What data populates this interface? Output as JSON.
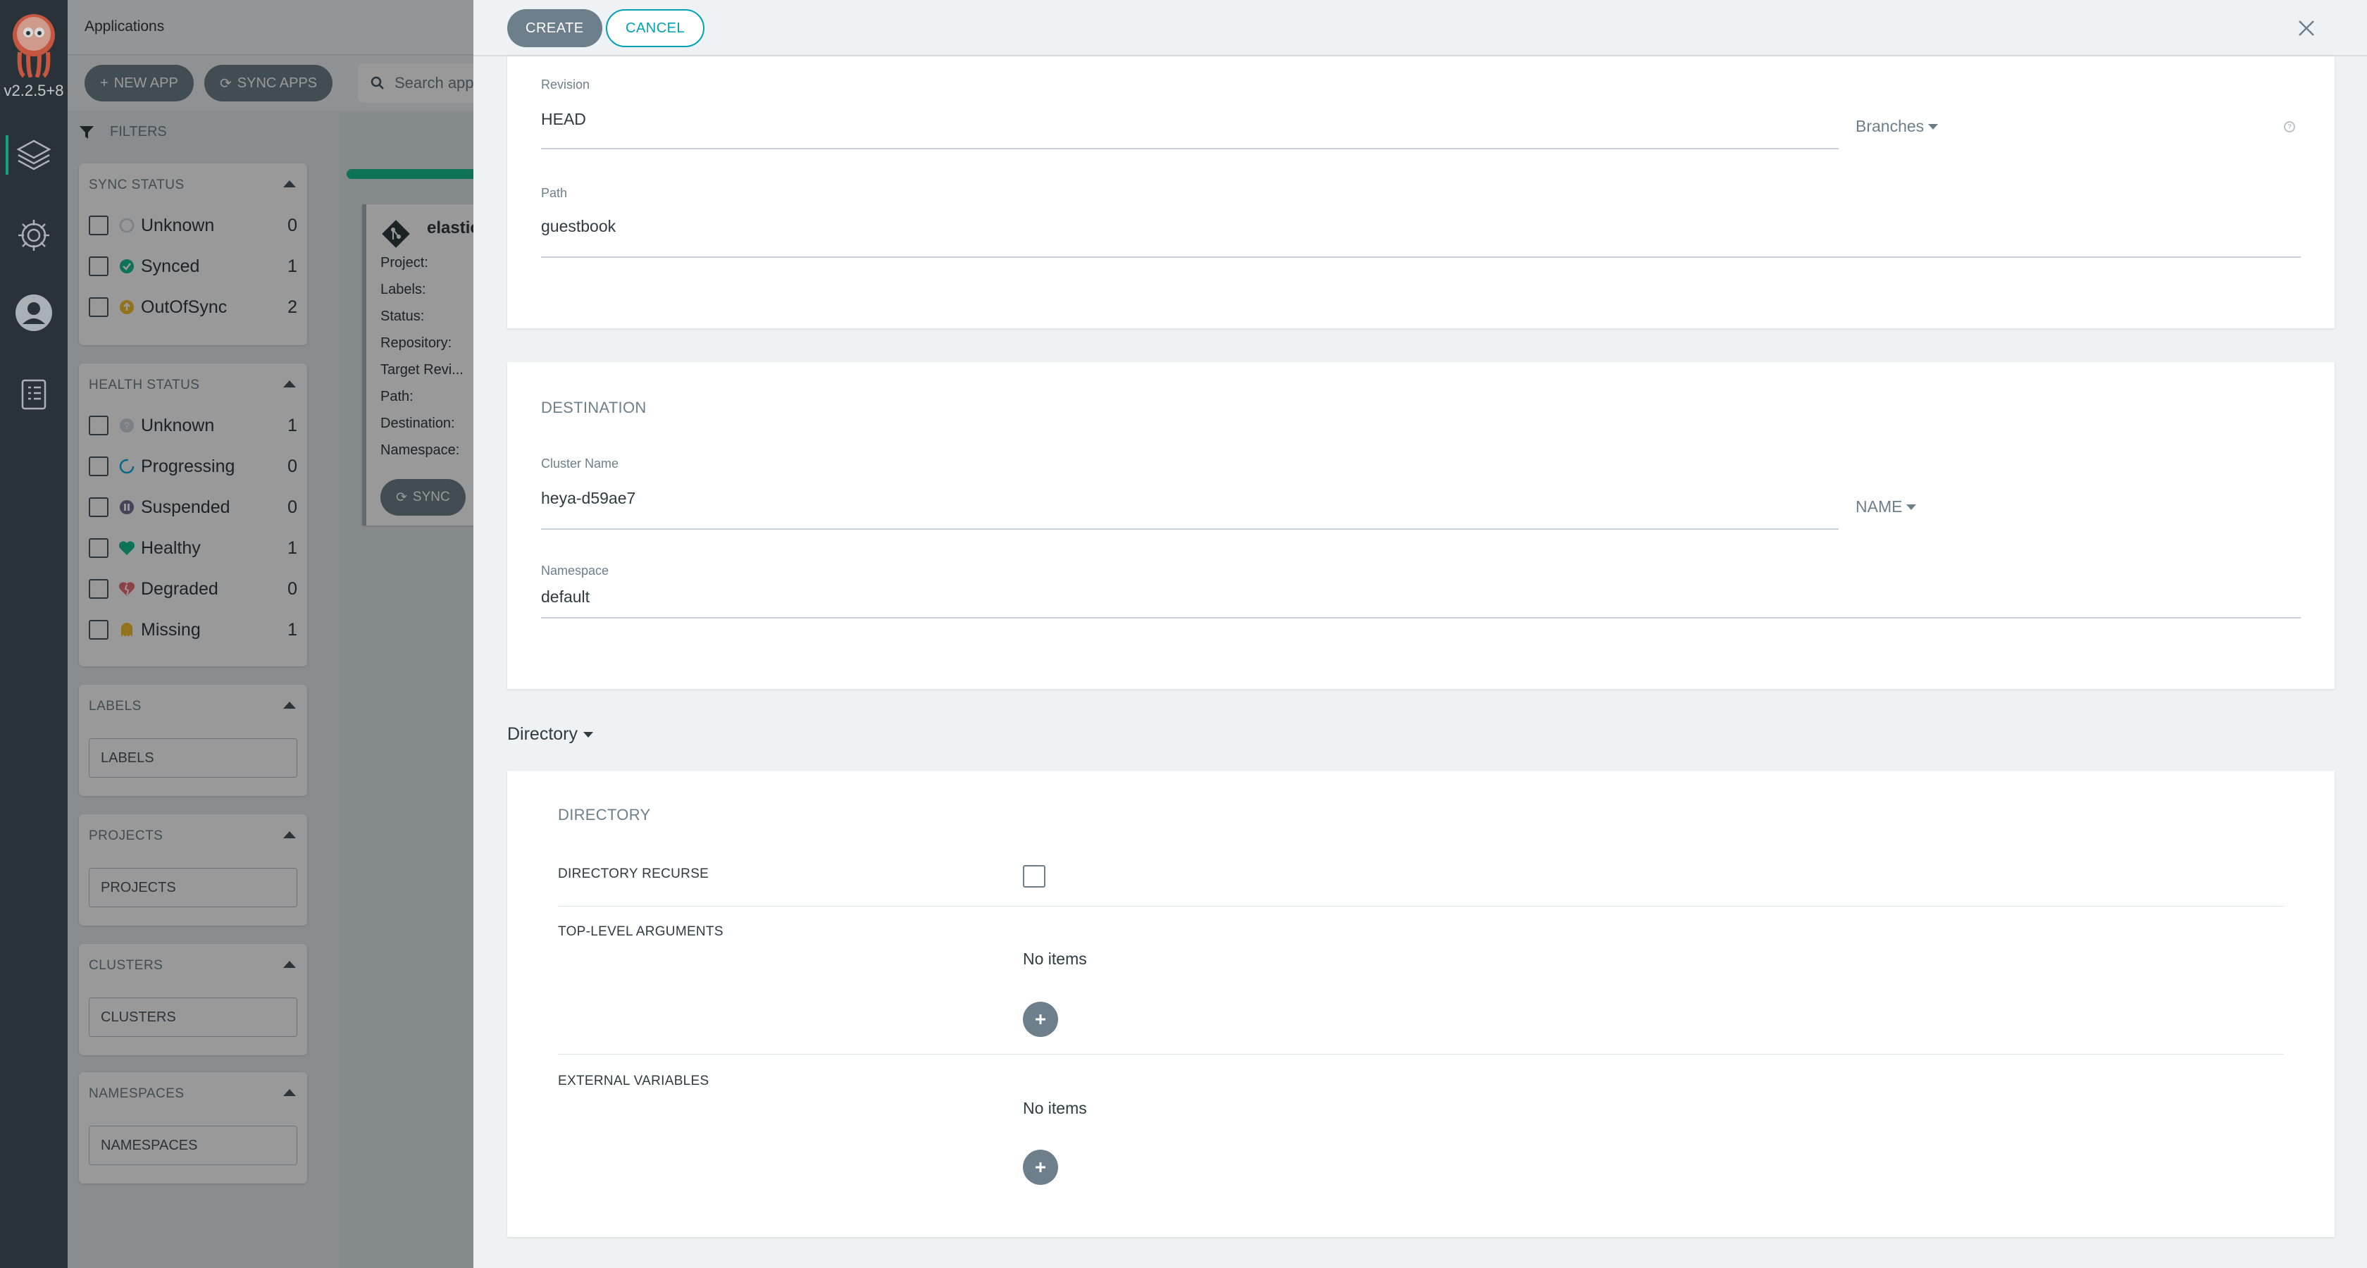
{
  "nav": {
    "version": "v2.2.5+8",
    "items": [
      {
        "icon": "layers-icon"
      },
      {
        "icon": "gear-icon"
      },
      {
        "icon": "user-icon"
      },
      {
        "icon": "docs-icon"
      }
    ]
  },
  "background": {
    "title": "Applications",
    "new_app_label": "NEW APP",
    "sync_apps_label": "SYNC APPS",
    "search_placeholder": "Search app",
    "filters_label": "FILTERS",
    "sync_status": {
      "title": "SYNC STATUS",
      "items": [
        {
          "label": "Unknown",
          "count": "0",
          "color": "#ccd6dd"
        },
        {
          "label": "Synced",
          "count": "1",
          "color": "#18be94"
        },
        {
          "label": "OutOfSync",
          "count": "2",
          "color": "#f4c030"
        }
      ]
    },
    "health_status": {
      "title": "HEALTH STATUS",
      "items": [
        {
          "label": "Unknown",
          "count": "1",
          "color": "#ccd6dd"
        },
        {
          "label": "Progressing",
          "count": "0",
          "color": "#0dadea"
        },
        {
          "label": "Suspended",
          "count": "0",
          "color": "#766f94"
        },
        {
          "label": "Healthy",
          "count": "1",
          "color": "#18be94"
        },
        {
          "label": "Degraded",
          "count": "0",
          "color": "#e96d76"
        },
        {
          "label": "Missing",
          "count": "1",
          "color": "#f4c030"
        }
      ]
    },
    "labels": {
      "title": "LABELS",
      "placeholder": "LABELS"
    },
    "projects": {
      "title": "PROJECTS",
      "placeholder": "PROJECTS"
    },
    "clusters": {
      "title": "CLUSTERS",
      "placeholder": "CLUSTERS"
    },
    "namespaces": {
      "title": "NAMESPACES",
      "placeholder": "NAMESPACES"
    },
    "app_card": {
      "name": "elastic",
      "fields": [
        "Project:",
        "Labels:",
        "Status:",
        "Repository:",
        "Target Revi...",
        "Path:",
        "Destination:",
        "Namespace:"
      ],
      "sync_label": "SYNC"
    }
  },
  "panel": {
    "create_label": "CREATE",
    "cancel_label": "CANCEL",
    "source": {
      "revision_label": "Revision",
      "revision_value": "HEAD",
      "revision_type": "Branches",
      "path_label": "Path",
      "path_value": "guestbook"
    },
    "destination": {
      "title": "DESTINATION",
      "cluster_label": "Cluster Name",
      "cluster_value": "heya-d59ae7",
      "cluster_mode": "NAME",
      "namespace_label": "Namespace",
      "namespace_value": "default"
    },
    "directory_toggle": "Directory",
    "directory": {
      "title": "DIRECTORY",
      "recurse_label": "DIRECTORY RECURSE",
      "tla_label": "TOP-LEVEL ARGUMENTS",
      "tla_empty": "No items",
      "ext_label": "EXTERNAL VARIABLES",
      "ext_empty": "No items"
    }
  },
  "colors": {
    "accent": "#18be94",
    "button": "#6d7f8b",
    "link": "#00a2b3"
  }
}
